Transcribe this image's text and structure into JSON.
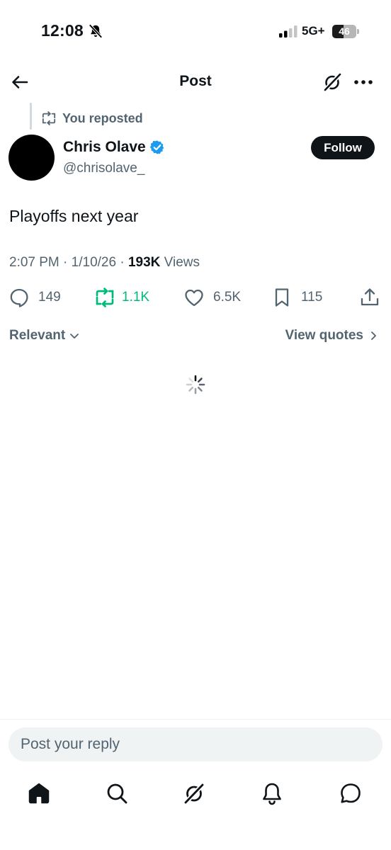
{
  "status_bar": {
    "time": "12:08",
    "network": "5G+",
    "battery_level": "46",
    "battery_fraction": 0.46
  },
  "header": {
    "title": "Post"
  },
  "repost_context": {
    "text": "You reposted"
  },
  "author": {
    "name": "Chris Olave",
    "handle": "@chrisolave_",
    "verified_color": "#1d9bf0",
    "follow_label": "Follow"
  },
  "post": {
    "text": "Playoffs next year",
    "time": "2:07 PM",
    "date": "1/10/26",
    "separator": "·",
    "views_count": "193K",
    "views_label": "Views"
  },
  "actions": {
    "replies": "149",
    "reposts": "1.1K",
    "likes": "6.5K",
    "bookmarks": "115",
    "repost_active_color": "#00ba7c"
  },
  "sort": {
    "relevant_label": "Relevant",
    "view_quotes_label": "View quotes"
  },
  "reply": {
    "placeholder": "Post your reply"
  },
  "icons": {
    "back": "arrow-left-icon",
    "grok": "grok-icon",
    "more": "more-horizontal-icon",
    "repost": "repost-icon",
    "verified": "verified-badge-icon",
    "reply": "reply-icon",
    "like": "heart-icon",
    "bookmark": "bookmark-icon",
    "share": "share-icon",
    "chevron_down": "chevron-down-icon",
    "chevron_right": "chevron-right-icon",
    "spinner": "loading-spinner-icon",
    "nav": [
      "home-icon",
      "search-icon",
      "grok-icon",
      "notifications-icon",
      "messages-icon"
    ]
  }
}
